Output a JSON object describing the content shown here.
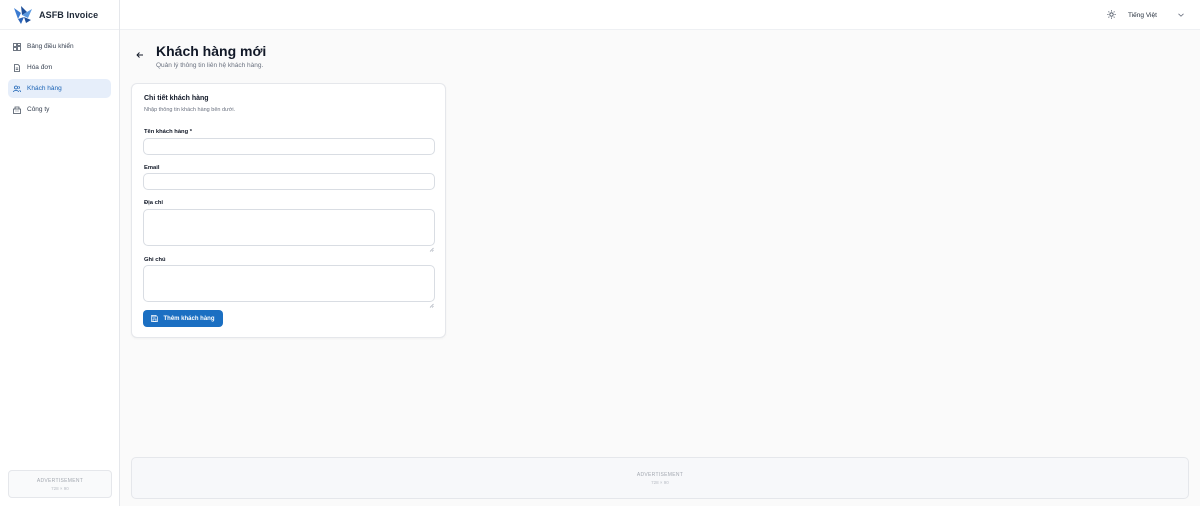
{
  "brand": {
    "name": "ASFB Invoice"
  },
  "sidebar": {
    "items": [
      {
        "label": "Bảng điều khiển",
        "icon": "dashboard-icon",
        "active": false
      },
      {
        "label": "Hóa đơn",
        "icon": "invoice-icon",
        "active": false
      },
      {
        "label": "Khách hàng",
        "icon": "users-icon",
        "active": true
      },
      {
        "label": "Công ty",
        "icon": "building-icon",
        "active": false
      }
    ],
    "ad": {
      "label": "ADVERTISEMENT",
      "size": "728 × 90"
    }
  },
  "topbar": {
    "theme_icon": "sun-icon",
    "language": "Tiếng Việt"
  },
  "page": {
    "title": "Khách hàng mới",
    "subtitle": "Quản lý thông tin liên hệ khách hàng."
  },
  "form": {
    "title": "Chi tiết khách hàng",
    "description": "Nhập thông tin khách hàng bên dưới.",
    "fields": {
      "name": {
        "label": "Tên khách hàng *",
        "value": ""
      },
      "email": {
        "label": "Email",
        "value": ""
      },
      "address": {
        "label": "Địa chỉ",
        "value": ""
      },
      "notes": {
        "label": "Ghi chú",
        "value": ""
      }
    },
    "submit_label": "Thêm khách hàng"
  },
  "footer_ad": {
    "label": "ADVERTISEMENT",
    "size": "728 × 90"
  },
  "colors": {
    "accent": "#1b6fc2",
    "active_nav_bg": "#e6eefa",
    "active_nav_text": "#1b63b5",
    "page_bg": "#fafafa"
  }
}
